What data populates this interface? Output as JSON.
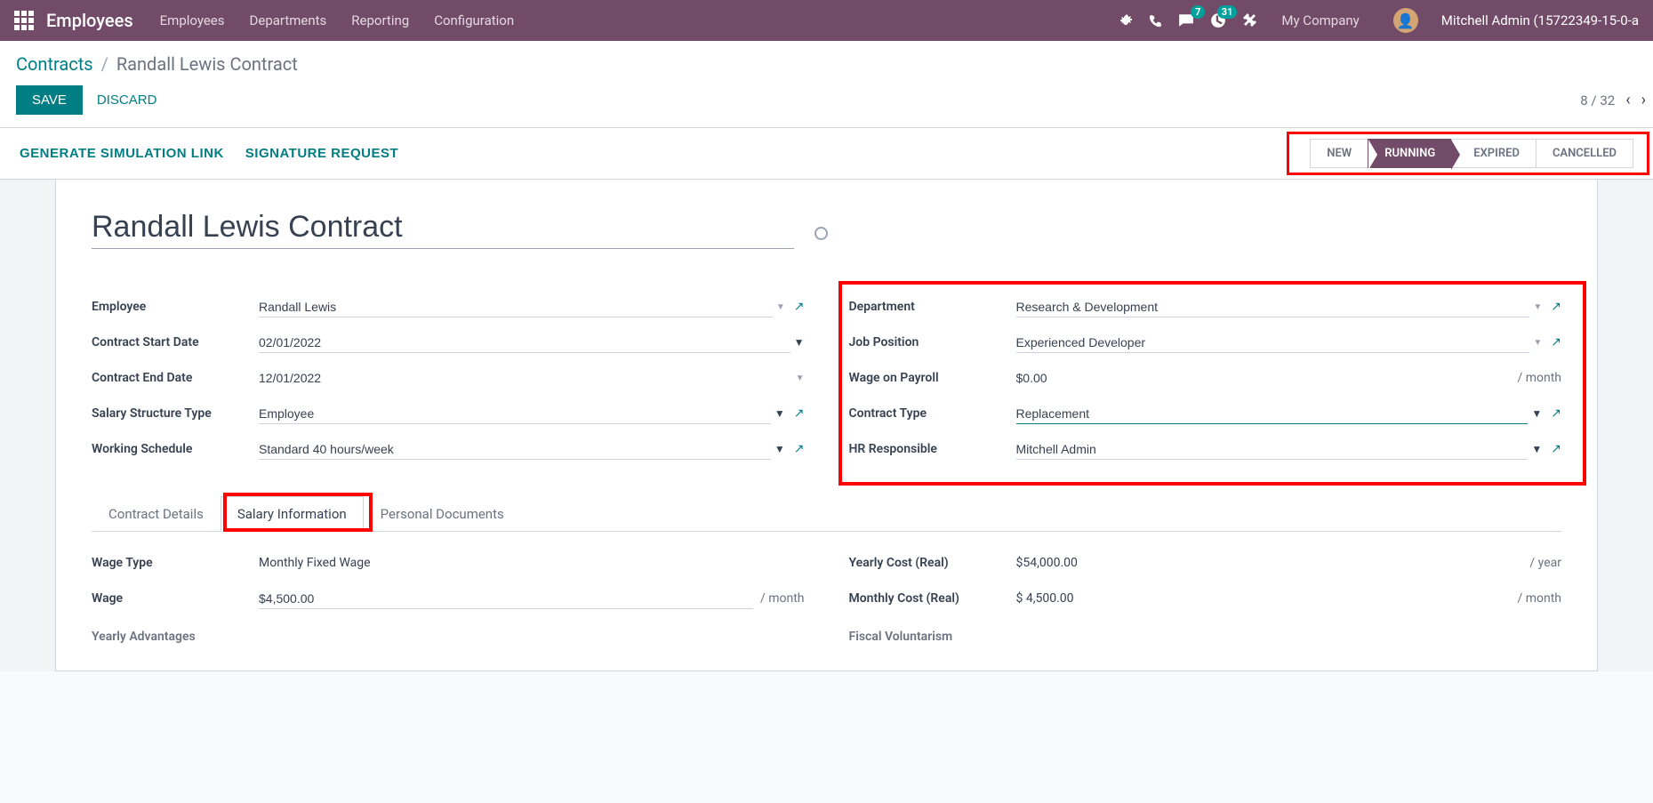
{
  "nav": {
    "app_title": "Employees",
    "menu": [
      "Employees",
      "Departments",
      "Reporting",
      "Configuration"
    ],
    "messages_badge": "7",
    "activities_badge": "31",
    "company": "My Company",
    "username": "Mitchell Admin (15722349-15-0-a"
  },
  "breadcrumb": {
    "parent": "Contracts",
    "current": "Randall Lewis Contract"
  },
  "actions": {
    "save": "SAVE",
    "discard": "DISCARD",
    "sim_link": "GENERATE SIMULATION LINK",
    "sig_request": "SIGNATURE REQUEST"
  },
  "pager": {
    "text": "8 / 32"
  },
  "statuses": [
    "NEW",
    "RUNNING",
    "EXPIRED",
    "CANCELLED"
  ],
  "form": {
    "title": "Randall Lewis Contract",
    "left": {
      "employee_label": "Employee",
      "employee": "Randall Lewis",
      "start_label": "Contract Start Date",
      "start": "02/01/2022",
      "end_label": "Contract End Date",
      "end": "12/01/2022",
      "struct_label": "Salary Structure Type",
      "struct": "Employee",
      "sched_label": "Working Schedule",
      "sched": "Standard 40 hours/week"
    },
    "right": {
      "dept_label": "Department",
      "dept": "Research & Development",
      "job_label": "Job Position",
      "job": "Experienced Developer",
      "wage_payroll_label": "Wage on Payroll",
      "wage_payroll": "$0.00",
      "wage_payroll_suffix": "/ month",
      "ctype_label": "Contract Type",
      "ctype": "Replacement",
      "hr_label": "HR Responsible",
      "hr": "Mitchell Admin"
    }
  },
  "tabs": [
    "Contract Details",
    "Salary Information",
    "Personal Documents"
  ],
  "salary": {
    "wage_type_label": "Wage Type",
    "wage_type": "Monthly Fixed Wage",
    "wage_label": "Wage",
    "wage": "$4,500.00",
    "wage_suffix": "/ month",
    "yearly_adv": "Yearly Advantages",
    "yearly_cost_label": "Yearly Cost (Real)",
    "yearly_cost": "$54,000.00",
    "yearly_cost_suffix": "/ year",
    "monthly_cost_label": "Monthly Cost (Real)",
    "monthly_cost": "$ 4,500.00",
    "monthly_cost_suffix": "/ month",
    "fiscal": "Fiscal Voluntarism"
  }
}
